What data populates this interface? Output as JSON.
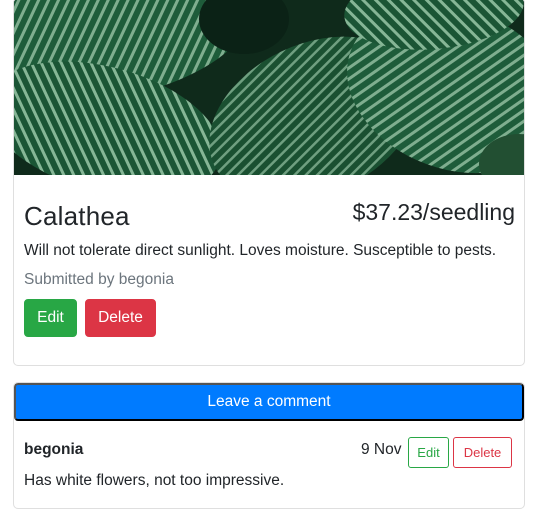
{
  "plant": {
    "image_subject": "calathea-leaves-photo",
    "name": "Calathea",
    "price": "$37.23/seedling",
    "description": "Will not tolerate direct sunlight. Loves moisture. Susceptible to pests.",
    "submitted_by": "Submitted by begonia",
    "edit_label": "Edit",
    "delete_label": "Delete"
  },
  "comments": {
    "leave_comment_label": "Leave a comment",
    "items": [
      {
        "author": "begonia",
        "date": "9 Nov",
        "text": "Has white flowers, not too impressive.",
        "edit_label": "Edit",
        "delete_label": "Delete"
      }
    ]
  },
  "colors": {
    "success": "#28a745",
    "danger": "#dc3545",
    "primary": "#007bff",
    "muted": "#6c757d"
  }
}
